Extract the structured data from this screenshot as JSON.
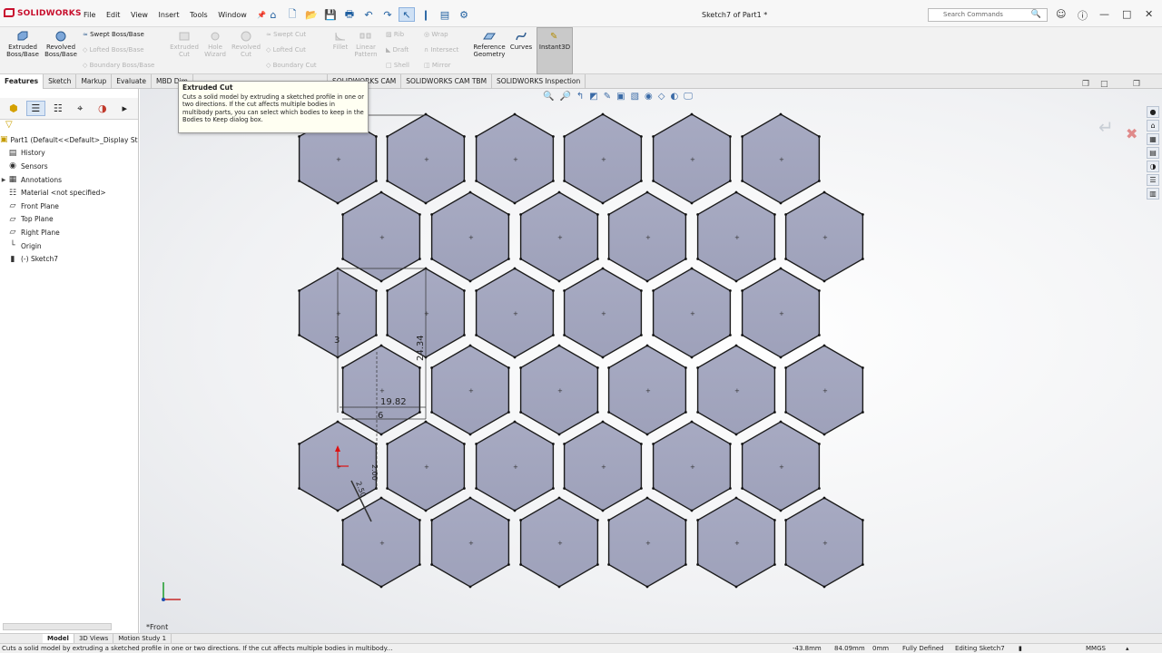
{
  "app": {
    "logo": "SOLIDWORKS",
    "menus": [
      "File",
      "Edit",
      "View",
      "Insert",
      "Tools",
      "Window"
    ],
    "document_title": "Sketch7 of Part1 *",
    "search_placeholder": "Search Commands"
  },
  "command_manager": {
    "extruded_boss": "Extruded\nBoss/Base",
    "revolved_boss": "Revolved\nBoss/Base",
    "swept_boss": "Swept Boss/Base",
    "lofted_boss": "Lofted Boss/Base",
    "boundary_boss": "Boundary Boss/Base",
    "extruded_cut": "Extruded\nCut",
    "hole_wizard": "Hole\nWizard",
    "revolved_cut": "Revolved\nCut",
    "swept_cut": "Swept Cut",
    "lofted_cut": "Lofted Cut",
    "boundary_cut": "Boundary Cut",
    "fillet": "Fillet",
    "linear_pattern": "Linear\nPattern",
    "rib": "Rib",
    "draft": "Draft",
    "shell": "Shell",
    "wrap": "Wrap",
    "intersect": "Intersect",
    "mirror": "Mirror",
    "reference_geometry": "Reference\nGeometry",
    "curves": "Curves",
    "instant3d": "Instant3D"
  },
  "tabs": [
    "Features",
    "Sketch",
    "Markup",
    "Evaluate",
    "MBD Dim",
    "",
    "SOLIDWORKS CAM",
    "SOLIDWORKS CAM TBM",
    "SOLIDWORKS Inspection"
  ],
  "tooltip": {
    "title": "Extruded Cut",
    "body": "Cuts a solid model by extruding a sketched profile in one or two directions. If the cut affects multiple bodies in multibody parts, you can select which bodies to keep in the Bodies to Keep dialog box."
  },
  "feature_tree": [
    {
      "label": "Part1  (Default<<Default>_Display Sta",
      "icon": "part-icon"
    },
    {
      "label": "History",
      "icon": "history-icon"
    },
    {
      "label": "Sensors",
      "icon": "sensors-icon"
    },
    {
      "label": "Annotations",
      "icon": "annotations-icon"
    },
    {
      "label": "Material <not specified>",
      "icon": "material-icon"
    },
    {
      "label": "Front Plane",
      "icon": "plane-icon"
    },
    {
      "label": "Top Plane",
      "icon": "plane-icon"
    },
    {
      "label": "Right Plane",
      "icon": "plane-icon"
    },
    {
      "label": "Origin",
      "icon": "origin-icon"
    },
    {
      "label": "(-) Sketch7",
      "icon": "sketch-icon"
    }
  ],
  "sketch": {
    "dimensions": [
      "3",
      "24.34",
      "19.82",
      "6",
      "2.00",
      "2.50"
    ]
  },
  "view_label": "*Front",
  "model_tabs": [
    "Model",
    "3D Views",
    "Motion Study 1"
  ],
  "status": {
    "message": "Cuts a solid model by extruding a sketched profile in one or two directions. If the cut affects multiple bodies in multibody...",
    "x": "-43.8mm",
    "y": "84.09mm",
    "z": "0mm",
    "state": "Fully Defined",
    "editing": "Editing Sketch7",
    "units": "MMGS"
  }
}
